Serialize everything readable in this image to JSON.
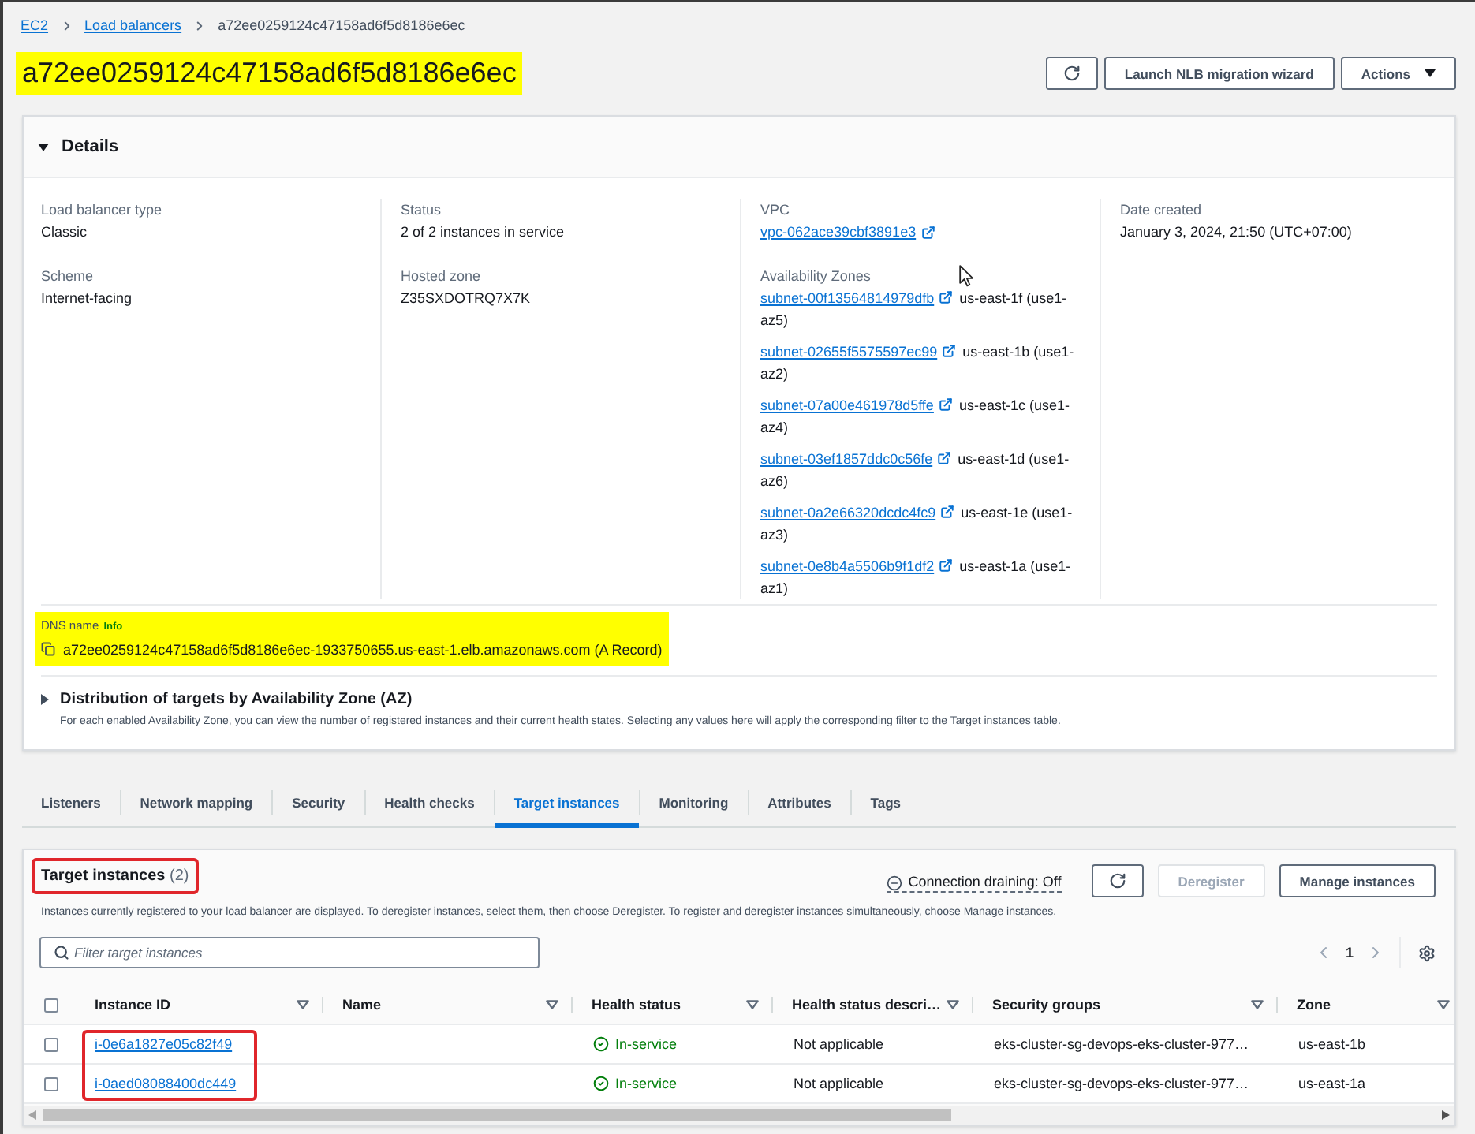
{
  "breadcrumbs": [
    {
      "text": "EC2",
      "kind": "link"
    },
    {
      "text": "Load balancers",
      "kind": "link"
    },
    {
      "text": "a72ee0259124c47158ad6f5d8186e6ec",
      "kind": "current"
    }
  ],
  "title": {
    "text": "a72ee0259124c47158ad6f5d8186e6ec",
    "highlighted": true
  },
  "header_buttons": [
    {
      "kind": "refresh"
    },
    {
      "kind": "text",
      "label": "Launch NLB migration wizard"
    },
    {
      "kind": "dropdown",
      "label": "Actions"
    }
  ],
  "details": {
    "title": "Details",
    "expanded": true,
    "columns": [
      [
        {
          "label": "Load balancer type",
          "kind": "text",
          "value": "Classic"
        },
        {
          "label": "Scheme",
          "kind": "text",
          "value": "Internet-facing"
        }
      ],
      [
        {
          "label": "Status",
          "kind": "text",
          "value": "2 of 2 instances in service"
        },
        {
          "label": "Hosted zone",
          "kind": "text",
          "value": "Z35SXDOTRQ7X7K"
        }
      ],
      [
        {
          "label": "VPC",
          "kind": "link",
          "value": "vpc-062ace39cbf3891e3"
        },
        {
          "label": "Availability Zones",
          "kind": "subnets",
          "items": [
            {
              "link": "subnet-00f13564814979dfb",
              "zone": "us-east-1f (use1-az5)"
            },
            {
              "link": "subnet-02655f5575597ec99",
              "zone": "us-east-1b (use1-az2)"
            },
            {
              "link": "subnet-07a00e461978d5ffe",
              "zone": "us-east-1c (use1-az4)"
            },
            {
              "link": "subnet-03ef1857ddc0c56fe",
              "zone": "us-east-1d (use1-az6)"
            },
            {
              "link": "subnet-0a2e66320dcdc4fc9",
              "zone": "us-east-1e (use1-az3)"
            },
            {
              "link": "subnet-0e8b4a5506b9f1df2",
              "zone": "us-east-1a (use1-az1)"
            }
          ]
        }
      ],
      [
        {
          "label": "Date created",
          "kind": "text",
          "value": "January 3, 2024, 21:50 (UTC+07:00)"
        }
      ]
    ],
    "dns_name": {
      "label": "DNS name",
      "info": "Info",
      "value": "a72ee0259124c47158ad6f5d8186e6ec-1933750655.us-east-1.elb.amazonaws.com (A Record)",
      "highlighted": true
    },
    "distribution": {
      "title": "Distribution of targets by Availability Zone (AZ)",
      "expanded": false,
      "description": "For each enabled Availability Zone, you can view the number of registered instances and their current health states. Selecting any values here will apply the corresponding filter to the Target instances table."
    }
  },
  "tabs": [
    {
      "label": "Listeners",
      "selected": false
    },
    {
      "label": "Network mapping",
      "selected": false
    },
    {
      "label": "Security",
      "selected": false
    },
    {
      "label": "Health checks",
      "selected": false
    },
    {
      "label": "Target instances",
      "selected": true
    },
    {
      "label": "Monitoring",
      "selected": false
    },
    {
      "label": "Attributes",
      "selected": false
    },
    {
      "label": "Tags",
      "selected": false
    }
  ],
  "target_instances": {
    "title": "Target instances",
    "count": "(2)",
    "outlined": true,
    "connection_draining": "Connection draining: Off",
    "buttons": [
      {
        "kind": "refresh",
        "disabled": false
      },
      {
        "kind": "text",
        "label": "Deregister",
        "disabled": true
      },
      {
        "kind": "text",
        "label": "Manage instances",
        "disabled": false
      }
    ],
    "description": "Instances currently registered to your load balancer are displayed. To deregister instances, select them, then choose Deregister. To register and deregister instances simultaneously, choose Manage instances.",
    "filter": {
      "placeholder": "Filter target instances"
    },
    "pagination": {
      "page": "1"
    },
    "table": {
      "select_all_checked": false,
      "id_column_outlined": true,
      "columns": [
        "Instance ID",
        "Name",
        "Health status",
        "Health status descri…",
        "Security groups",
        "Zone"
      ],
      "rows": [
        {
          "selected": false,
          "instance_id": "i-0e6a1827e05c82f49",
          "health_status": "In-service",
          "healthy": true,
          "health_status_description": "Not applicable",
          "security_groups": "eks-cluster-sg-devops-eks-cluster-977…",
          "zone": "us-east-1b"
        },
        {
          "selected": false,
          "instance_id": "i-0aed08088400dc449",
          "health_status": "In-service",
          "healthy": true,
          "health_status_description": "Not applicable",
          "security_groups": "eks-cluster-sg-devops-eks-cluster-977…",
          "zone": "us-east-1a"
        }
      ]
    }
  }
}
